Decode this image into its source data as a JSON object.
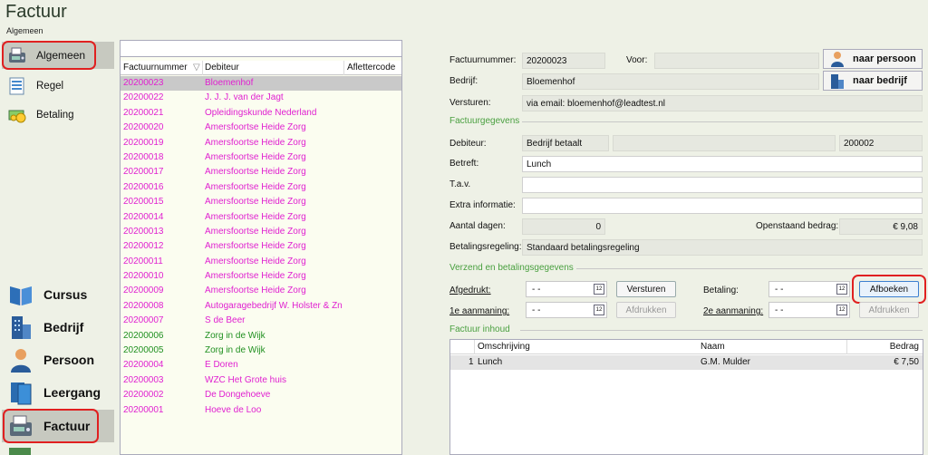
{
  "header": {
    "title": "Factuur",
    "subtitle": "Algemeen"
  },
  "nav_top": [
    {
      "label": "Algemeen",
      "icon": "fax-icon"
    },
    {
      "label": "Regel",
      "icon": "document-lines-icon"
    },
    {
      "label": "Betaling",
      "icon": "money-icon"
    }
  ],
  "nav_bottom": [
    {
      "label": "Cursus",
      "icon": "book-icon"
    },
    {
      "label": "Bedrijf",
      "icon": "building-icon"
    },
    {
      "label": "Persoon",
      "icon": "person-icon"
    },
    {
      "label": "Leergang",
      "icon": "folder-icon"
    },
    {
      "label": "Factuur",
      "icon": "fax-icon"
    }
  ],
  "list": {
    "columns": [
      "Factuurnummer",
      "Debiteur",
      "Aflettercode"
    ],
    "sort_icon": "▽",
    "rows": [
      {
        "nr": "20200023",
        "debiteur": "Bloemenhof",
        "status": "pink"
      },
      {
        "nr": "20200022",
        "debiteur": "J. J. J. van der Jagt",
        "status": "pink"
      },
      {
        "nr": "20200021",
        "debiteur": "Opleidingskunde Nederland",
        "status": "pink"
      },
      {
        "nr": "20200020",
        "debiteur": "Amersfoortse Heide Zorg",
        "status": "pink"
      },
      {
        "nr": "20200019",
        "debiteur": "Amersfoortse Heide Zorg",
        "status": "pink"
      },
      {
        "nr": "20200018",
        "debiteur": "Amersfoortse Heide Zorg",
        "status": "pink"
      },
      {
        "nr": "20200017",
        "debiteur": "Amersfoortse Heide Zorg",
        "status": "pink"
      },
      {
        "nr": "20200016",
        "debiteur": "Amersfoortse Heide Zorg",
        "status": "pink"
      },
      {
        "nr": "20200015",
        "debiteur": "Amersfoortse Heide Zorg",
        "status": "pink"
      },
      {
        "nr": "20200014",
        "debiteur": "Amersfoortse Heide Zorg",
        "status": "pink"
      },
      {
        "nr": "20200013",
        "debiteur": "Amersfoortse Heide Zorg",
        "status": "pink"
      },
      {
        "nr": "20200012",
        "debiteur": "Amersfoortse Heide Zorg",
        "status": "pink"
      },
      {
        "nr": "20200011",
        "debiteur": "Amersfoortse Heide Zorg",
        "status": "pink"
      },
      {
        "nr": "20200010",
        "debiteur": "Amersfoortse Heide Zorg",
        "status": "pink"
      },
      {
        "nr": "20200009",
        "debiteur": "Amersfoortse Heide Zorg",
        "status": "pink"
      },
      {
        "nr": "20200008",
        "debiteur": "Autogaragebedrijf W. Holster & Zn",
        "status": "pink"
      },
      {
        "nr": "20200007",
        "debiteur": "S de Beer",
        "status": "pink"
      },
      {
        "nr": "20200006",
        "debiteur": "Zorg in de Wijk",
        "status": "green"
      },
      {
        "nr": "20200005",
        "debiteur": "Zorg in de Wijk",
        "status": "green"
      },
      {
        "nr": "20200004",
        "debiteur": "E Doren",
        "status": "pink"
      },
      {
        "nr": "20200003",
        "debiteur": "WZC Het Grote huis",
        "status": "pink"
      },
      {
        "nr": "20200002",
        "debiteur": "De Dongehoeve",
        "status": "pink"
      },
      {
        "nr": "20200001",
        "debiteur": "Hoeve de Loo",
        "status": "pink"
      }
    ]
  },
  "form": {
    "factuurnummer_label": "Factuurnummer:",
    "factuurnummer": "20200023",
    "voor_label": "Voor:",
    "voor": "",
    "bedrijf_label": "Bedrijf:",
    "bedrijf": "Bloemenhof",
    "versturen_label": "Versturen:",
    "versturen": "via email: bloemenhof@leadtest.nl",
    "btn_persoon": "naar persoon",
    "btn_bedrijf": "naar bedrijf",
    "sect_factuur": "Factuurgegevens",
    "debiteur_label": "Debiteur:",
    "debiteur": "Bedrijf betaalt",
    "debiteur_mid": "",
    "debiteur_nr": "200002",
    "betreft_label": "Betreft:",
    "betreft": "Lunch",
    "tav_label": "T.a.v.",
    "tav": "",
    "extra_label": "Extra informatie:",
    "extra": "",
    "dagen_label": "Aantal dagen:",
    "dagen": "0",
    "openstaand_label": "Openstaand bedrag:",
    "openstaand": "€ 9,08",
    "regeling_label": "Betalingsregeling:",
    "regeling": "Standaard betalingsregeling",
    "sect_verzend": "Verzend en betalingsgegevens",
    "afgedrukt_label": "Afgedrukt:",
    "afgedrukt": "-  -",
    "aanmaning1_label": "1e aanmaning:",
    "aanmaning1": "-  -",
    "btn_versturen": "Versturen",
    "btn_afdrukken": "Afdrukken",
    "betaling_label": "Betaling:",
    "betaling": "-  -",
    "aanmaning2_label": "2e aanmaning:",
    "aanmaning2": "-  -",
    "btn_afboeken": "Afboeken",
    "btn_afdrukken2": "Afdrukken",
    "sect_inhoud": "Factuur inhoud",
    "table_cols": [
      "Omschrijving",
      "Naam",
      "Bedrag"
    ],
    "table_rows": [
      {
        "nr": "1",
        "omschrijving": "Lunch",
        "naam": "G.M. Mulder",
        "bedrag": "€ 7,50"
      }
    ]
  }
}
